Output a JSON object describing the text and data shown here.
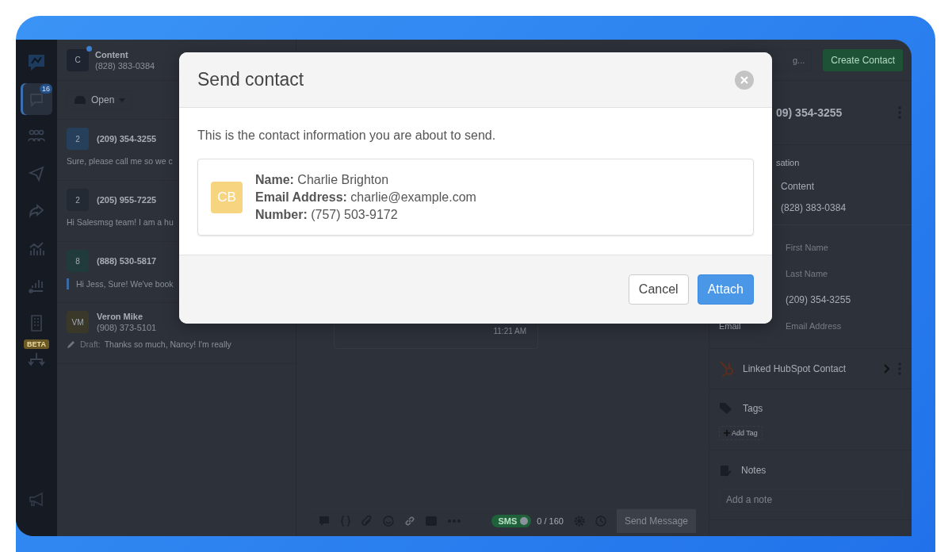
{
  "sidebar": {
    "items": [
      {
        "selected": false
      },
      {
        "selected": true,
        "badge": "16"
      },
      {
        "selected": false
      },
      {
        "selected": false
      },
      {
        "selected": false
      },
      {
        "selected": false
      },
      {
        "selected": false
      },
      {
        "selected": false
      },
      {
        "selected": false,
        "badge": "BETA"
      }
    ]
  },
  "conversation_header": {
    "avatar": "C",
    "name": "Content",
    "phone": "(828) 383-0384",
    "status_dot": true
  },
  "filter": {
    "label": "Open"
  },
  "conversations": [
    {
      "kind": "message",
      "avatar": "2",
      "title": "(209) 354-3255",
      "preview": "Sure, please call me so we c",
      "color": "#26405c"
    },
    {
      "kind": "message",
      "avatar": "2",
      "title": "(205) 955-7225",
      "preview": "Hi Salesmsg team! I am a hu",
      "color": "#242a34"
    },
    {
      "kind": "reply",
      "avatar": "8",
      "title": "(888) 530-5817",
      "preview": "Hi Jess, Sure! We've book",
      "color": "#213a3c"
    },
    {
      "kind": "draft",
      "avatar": "VM",
      "title": "Veron Mike",
      "subtitle": "(908) 373-5101",
      "draft_label": "Draft:",
      "preview": "Thanks so much, Nancy! I'm really",
      "color": "#3a3828"
    }
  ],
  "top_bar": {
    "search_placeholder": "g...",
    "create_button": "Create Contact"
  },
  "chat": {
    "message_time": "11:21 AM"
  },
  "composer": {
    "channel": "SMS",
    "channel_on": true,
    "counter": "0 / 160",
    "send_button": "Send Message"
  },
  "contact_panel": {
    "title": "09) 354-3255",
    "section_label": "sation",
    "fields": [
      {
        "kind": "value",
        "text": "Content"
      },
      {
        "kind": "value",
        "text": "(828) 383-0384"
      },
      {
        "kind": "input",
        "placeholder": "First Name"
      },
      {
        "kind": "input",
        "placeholder": "Last Name"
      },
      {
        "kind": "input",
        "value": "(209) 354-3255"
      },
      {
        "kind": "input",
        "label": "Email",
        "placeholder": "Email Address"
      }
    ],
    "hubspot": "Linked HubSpot Contact",
    "tags": "Tags",
    "add_tag": "Add Tag",
    "notes": "Notes",
    "note_placeholder": "Add a note"
  },
  "modal": {
    "title": "Send contact",
    "intro": "This is the contact information you are about to send.",
    "initials": "CB",
    "details": [
      {
        "label": "Name:",
        "value": "Charlie Brighton"
      },
      {
        "label": "Email Address:",
        "value": "charlie@example.com"
      },
      {
        "label": "Number:",
        "value": "(757) 503-9172"
      }
    ],
    "buttons": [
      {
        "kind": "secondary",
        "label": "Cancel"
      },
      {
        "kind": "primary",
        "label": "Attach"
      }
    ]
  }
}
